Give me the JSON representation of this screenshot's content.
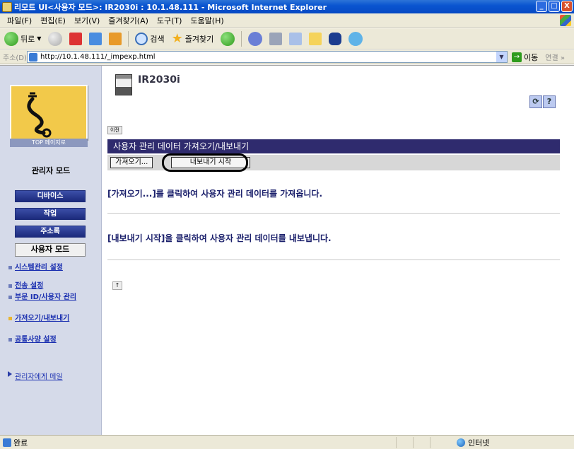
{
  "window": {
    "title": "리모트 UI<사용자 모드>: IR2030i : 10.1.48.111 - Microsoft Internet Explorer",
    "controls": [
      "_",
      "□",
      "X"
    ]
  },
  "menu": [
    "파일(F)",
    "편집(E)",
    "보기(V)",
    "즐겨찾기(A)",
    "도구(T)",
    "도움말(H)"
  ],
  "toolbar": {
    "back_label": "뒤로",
    "search_label": "검색",
    "favorites_label": "즐겨찾기"
  },
  "address": {
    "label": "주소(D)",
    "url": "http://10.1.48.111/_impexp.html",
    "go_label": "이동",
    "links_label": "연결 »"
  },
  "sidebar": {
    "logo_caption": "TOP 페이지로",
    "mode_label": "관리자 모드",
    "nav_buttons": [
      "디바이스",
      "작업",
      "주소록",
      "사용자 모드"
    ],
    "links": [
      "시스템관리 설정",
      "전송 설정",
      "부문 ID/사용자 관리",
      "가져오기/내보내기",
      "공통사양 설정"
    ],
    "mail_link": "관리자에게 메일"
  },
  "main": {
    "device_name": "IR2030i",
    "refresh_icon": "refresh-icon",
    "help_label": "?",
    "prev_label": "이전",
    "section_title": "사용자 관리 데이터 가져오기/내보내기",
    "import_button": "가져오기...",
    "export_button": "내보내기 시작",
    "import_instruction": "[가져오기...]를 클릭하여 사용자 관리 데이터를 가져옵니다.",
    "export_instruction": "[내보내기 시작]을 클릭하여 사용자 관리 데이터를 내보냅니다.",
    "top_link": "↑"
  },
  "status": {
    "left": "완료",
    "zone": "인터넷"
  },
  "colors": {
    "title_bar": "#0a55d0",
    "sidebar_bg": "#d5dae9",
    "nav_button": "#1c2a7c",
    "section_bar": "#2f2b6e",
    "instruction_text": "#1a1f6b"
  }
}
